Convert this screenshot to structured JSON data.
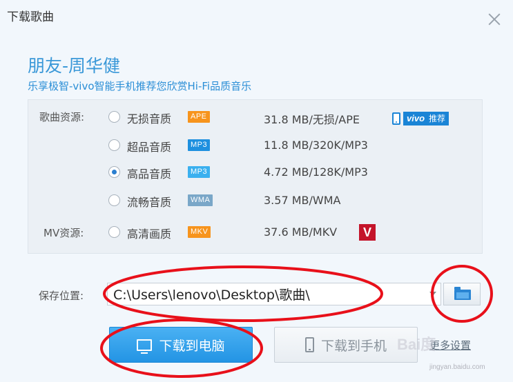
{
  "window": {
    "title": "下载歌曲"
  },
  "song": {
    "title": "朋友-周华健",
    "subtitle": "乐享极智-vivo智能手机推荐您欣赏Hi-Fi品质音乐"
  },
  "resources": {
    "song_label": "歌曲资源:",
    "mv_label": "MV资源:",
    "options": [
      {
        "quality": "无损音质",
        "format": "APE",
        "badge_color": "#f7941d",
        "size": "31.8 MB/无损/APE",
        "checked": false
      },
      {
        "quality": "超品音质",
        "format": "MP3",
        "badge_color": "#1e90df",
        "size": "11.8 MB/320K/MP3",
        "checked": false
      },
      {
        "quality": "高品音质",
        "format": "MP3",
        "badge_color": "#3ab0ef",
        "size": "4.72 MB/128K/MP3",
        "checked": true
      },
      {
        "quality": "流畅音质",
        "format": "WMA",
        "badge_color": "#7aa7c8",
        "size": "3.57 MB/WMA",
        "checked": false
      }
    ],
    "mv_option": {
      "quality": "高清画质",
      "format": "MKV",
      "badge_color": "#f7941d",
      "size": "37.6 MB/MKV",
      "checked": false
    },
    "vivo_badge": {
      "brand": "vivo",
      "text": "推荐"
    },
    "v_icon": "V"
  },
  "save": {
    "label": "保存位置:",
    "path": "C:\\Users\\lenovo\\Desktop\\歌曲\\"
  },
  "buttons": {
    "download_pc": "下载到电脑",
    "download_phone": "下载到手机",
    "more": "更多设置"
  },
  "watermark": {
    "logo": "Bai度",
    "url": "jingyan.baidu.com"
  },
  "colors": {
    "accent": "#2b8fd8",
    "annotation": "#e8101a"
  }
}
